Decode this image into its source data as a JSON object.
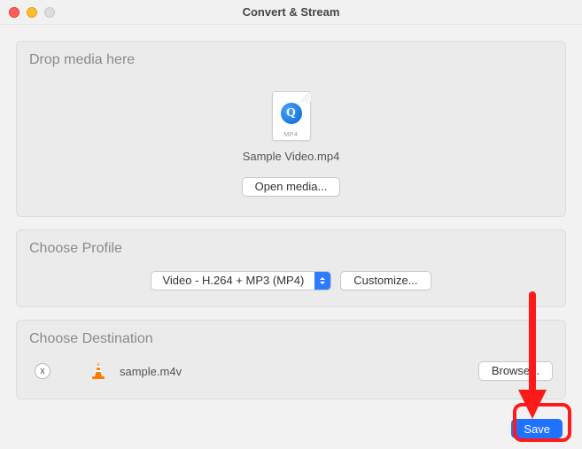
{
  "window": {
    "title": "Convert & Stream"
  },
  "drop": {
    "section_title": "Drop media here",
    "file_ext_badge": "MP4",
    "file_name": "Sample Video.mp4",
    "open_media_label": "Open media..."
  },
  "profile": {
    "section_title": "Choose Profile",
    "selected": "Video - H.264 + MP3 (MP4)",
    "customize_label": "Customize..."
  },
  "destination": {
    "section_title": "Choose Destination",
    "remove_aria": "x",
    "file_name": "sample.m4v",
    "browse_label": "Browse..."
  },
  "footer": {
    "save_label": "Save"
  },
  "annotation": {
    "color": "#ff1a1a"
  }
}
